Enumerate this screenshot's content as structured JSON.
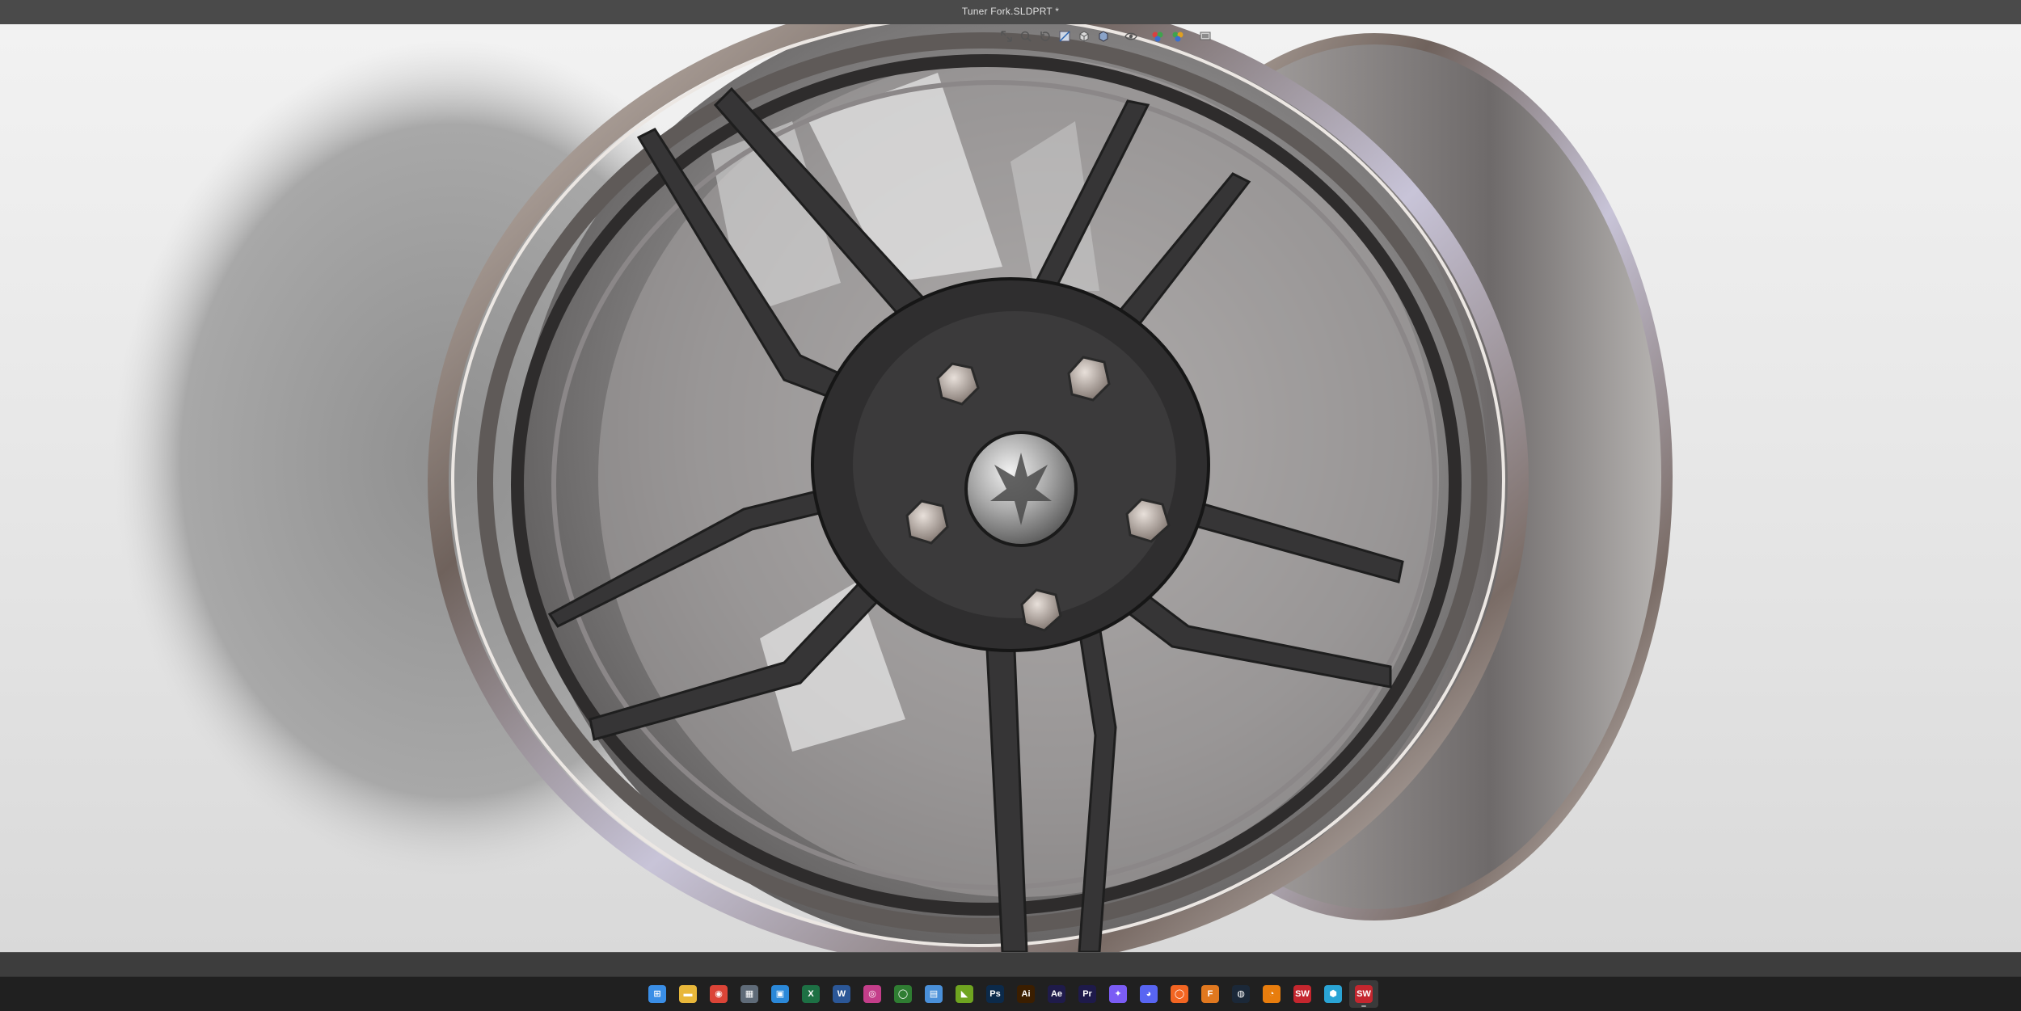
{
  "window": {
    "title": "Tuner Fork.SLDPRT *"
  },
  "heads_up_toolbar": [
    {
      "name": "zoom-to-fit-icon",
      "glyph": "⤢"
    },
    {
      "name": "zoom-to-area-icon",
      "glyph": "⌕"
    },
    {
      "name": "previous-view-icon",
      "glyph": "↶"
    },
    {
      "name": "section-view-icon",
      "glyph": "◧"
    },
    {
      "name": "view-orientation-icon",
      "glyph": "⬚"
    },
    {
      "name": "display-style-icon",
      "glyph": "◩"
    },
    {
      "name": "hide-show-items-icon",
      "glyph": "◐"
    },
    {
      "name": "edit-appearance-icon",
      "glyph": "◍"
    },
    {
      "name": "apply-scene-icon",
      "glyph": "◑"
    },
    {
      "name": "view-settings-icon",
      "glyph": "▭"
    }
  ],
  "colors": {
    "rim_chrome": "#8a7f78",
    "spoke_dark": "#3a3a3a",
    "barrel": "#8f8c8b",
    "shadow": "#9a9a9a"
  },
  "taskbar": {
    "apps": [
      {
        "name": "start-icon",
        "glyph": "⊞",
        "color": "#3a8ee6",
        "active": false
      },
      {
        "name": "file-explorer-icon",
        "glyph": "▬",
        "color": "#e8b73a",
        "active": false
      },
      {
        "name": "chrome-icon",
        "glyph": "◉",
        "color": "#db4437",
        "active": false
      },
      {
        "name": "calculator-icon",
        "glyph": "▦",
        "color": "#5f6b78",
        "active": false
      },
      {
        "name": "microsoft-store-icon",
        "glyph": "▣",
        "color": "#2b88d8",
        "active": false
      },
      {
        "name": "excel-icon",
        "glyph": "X",
        "color": "#1d7044",
        "active": false
      },
      {
        "name": "word-icon",
        "glyph": "W",
        "color": "#2b5797",
        "active": false
      },
      {
        "name": "camera-app-icon",
        "glyph": "◎",
        "color": "#c43e8a",
        "active": false
      },
      {
        "name": "xbox-icon",
        "glyph": "◯",
        "color": "#2f7d32",
        "active": false
      },
      {
        "name": "notepad-icon",
        "glyph": "▤",
        "color": "#4a90d9",
        "active": false
      },
      {
        "name": "nvidia-icon",
        "glyph": "◣",
        "color": "#6fa420",
        "active": false
      },
      {
        "name": "photoshop-icon",
        "glyph": "Ps",
        "color": "#0c2a4a",
        "active": false
      },
      {
        "name": "illustrator-icon",
        "glyph": "Ai",
        "color": "#3b1e00",
        "active": false
      },
      {
        "name": "after-effects-icon",
        "glyph": "Ae",
        "color": "#1f1b4a",
        "active": false
      },
      {
        "name": "premiere-pro-icon",
        "glyph": "Pr",
        "color": "#1e1a4a",
        "active": false
      },
      {
        "name": "messenger-icon",
        "glyph": "✦",
        "color": "#7b5cf5",
        "active": false
      },
      {
        "name": "discord-icon",
        "glyph": "◕",
        "color": "#5865f2",
        "active": false
      },
      {
        "name": "origin-icon",
        "glyph": "◯",
        "color": "#f26522",
        "active": false
      },
      {
        "name": "fusion-icon",
        "glyph": "F",
        "color": "#e0781f",
        "active": false
      },
      {
        "name": "steam-icon",
        "glyph": "◍",
        "color": "#1b2838",
        "active": false
      },
      {
        "name": "blender-icon",
        "glyph": "◔",
        "color": "#e87d0d",
        "active": false
      },
      {
        "name": "solidworks-2026-icon",
        "glyph": "SW",
        "color": "#c4262e",
        "active": false
      },
      {
        "name": "sketchup-icon",
        "glyph": "⬢",
        "color": "#2aa4d5",
        "active": false
      },
      {
        "name": "solidworks-2026-active-icon",
        "glyph": "SW",
        "color": "#c4262e",
        "active": true
      }
    ]
  }
}
